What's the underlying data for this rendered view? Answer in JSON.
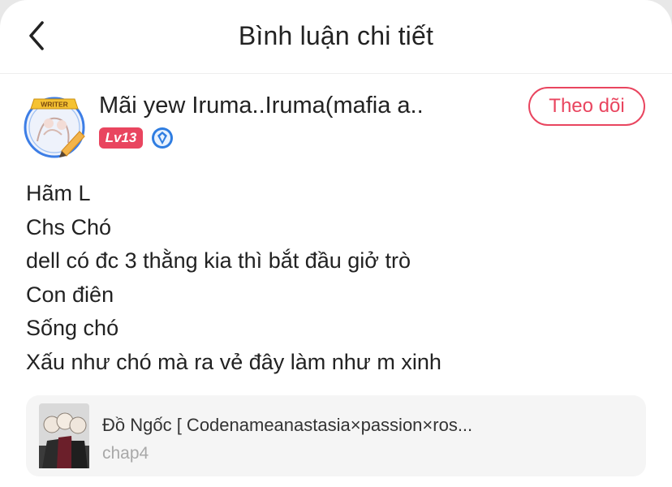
{
  "header": {
    "title": "Bình luận chi tiết",
    "back_icon": "chevron-left-icon"
  },
  "comment": {
    "author": {
      "name": "Mãi yew Iruma..Iruma(mafia a...",
      "avatar_badge_text": "WRITER",
      "level": "Lv13",
      "rank_icon": "blue-shield-rank-icon"
    },
    "follow_label": "Theo dõi",
    "lines": [
      "Hãm L",
      "Chs Chó",
      "dell có đc 3 thằng kia thì bắt đầu giở trò",
      "Con điên",
      "Sống chó",
      "Xấu như chó mà ra vẻ đây làm như m xinh"
    ]
  },
  "story": {
    "title": "Đồ Ngốc [ Codenameanastasia×passion×ros...",
    "chapter": "chap4"
  },
  "colors": {
    "accent": "#e9455f",
    "muted_text": "#a8a8a8",
    "card_bg": "#f5f5f5",
    "rank_blue": "#2f7de1"
  }
}
